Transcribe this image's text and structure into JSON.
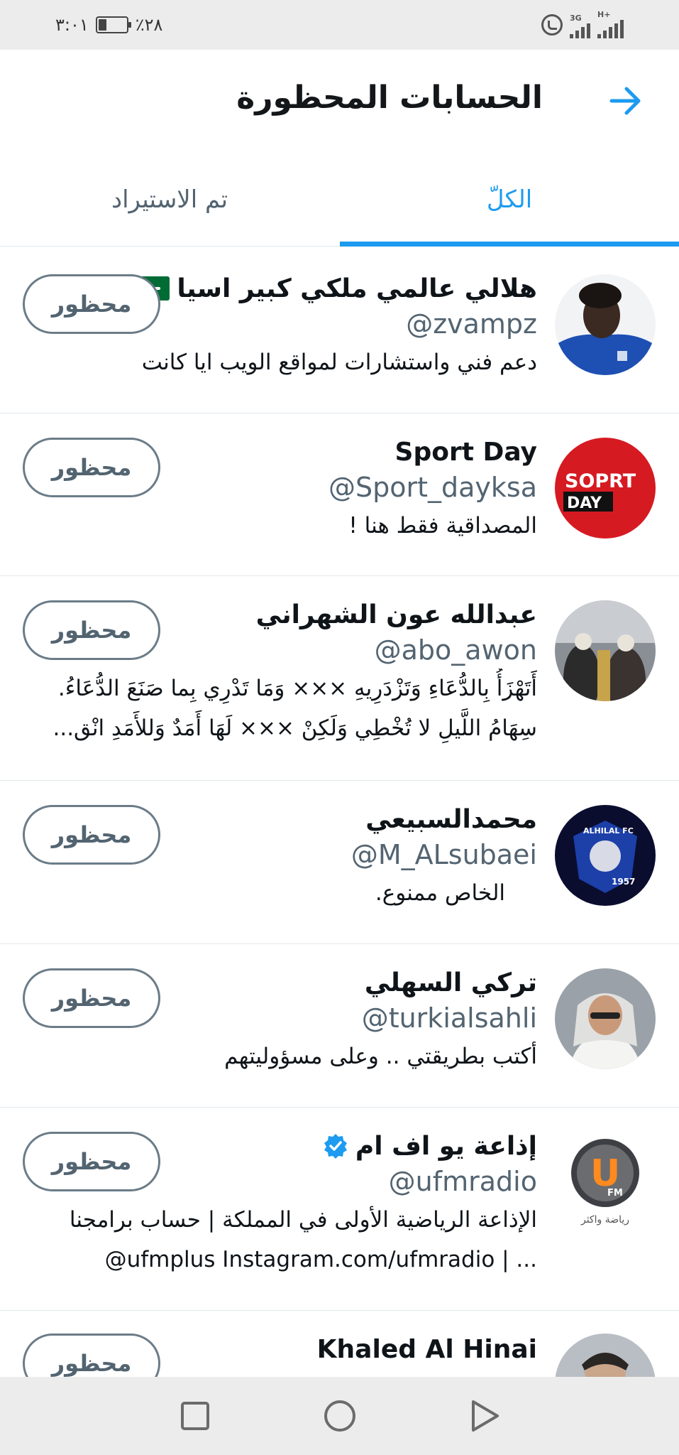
{
  "status_bar": {
    "time": "٣:٠١",
    "battery_percent": "٪٢٨",
    "battery_level": 0.28,
    "network_1": "3G",
    "network_2": "H+"
  },
  "header": {
    "title": "الحسابات المحظورة",
    "back_icon": "arrow-right-icon"
  },
  "tabs": {
    "all": "الكلّ",
    "imported": "تم الاستيراد",
    "active": "all"
  },
  "accounts": [
    {
      "name": "هلالي عالمي ملكي كبير اسيا",
      "badge": "flag",
      "handle": "@zvampz",
      "bio_lines": [
        "دعم فني واستشارات لمواقع الويب ايا كانت"
      ],
      "button": "محظور"
    },
    {
      "name": "Sport Day",
      "badge": "",
      "handle": "@Sport_dayksa",
      "bio_lines": [
        "المصداقية فقط هنا !"
      ],
      "avatar_text_1": "SOPRT",
      "avatar_text_2": "DAY",
      "button": "محظور"
    },
    {
      "name": "عبدالله عون الشهراني",
      "badge": "",
      "handle": "@abo_awon",
      "bio_lines": [
        "أَتَهْزَأُ بِالدُّعَاءِ وَتَزْدَرِيهِ ××× وَمَا تَدْرِي بِما صَنَعَ الدُّعَاءُ.",
        "سِهَامُ اللَّيلِ لا تُخْطِي وَلَكِنْ ××× لَهَا أَمَدٌ وَللأَمَدِ انْق..."
      ],
      "button": "محظور"
    },
    {
      "name": "محمدالسبيعي",
      "badge": "",
      "handle": "@M_ALsubaei",
      "bio_lines": [
        "الخاص ممنوع."
      ],
      "avatar_text_1": "ALHILAL FC",
      "avatar_text_2": "1957",
      "button": "محظور"
    },
    {
      "name": "تركي السهلي",
      "badge": "",
      "handle": "@turkialsahli",
      "bio_lines": [
        "أكتب بطريقتي .. وعلى مسؤوليتهم"
      ],
      "button": "محظور"
    },
    {
      "name": "إذاعة يو اف ام",
      "badge": "verified",
      "handle": "@ufmradio",
      "bio_lines": [
        "الإذاعة الرياضية الأولى في المملكة | حساب برامجنا",
        "@ufmplus Instagram.com/ufmradio | ..."
      ],
      "avatar_text_1": "U",
      "avatar_text_2": "FM",
      "avatar_text_3": "رياضة واكثر",
      "button": "محظور"
    },
    {
      "name": "Khaled Al Hinai",
      "badge": "",
      "handle": "",
      "bio_lines": [],
      "button": "محظور"
    }
  ],
  "nav_bar": {
    "recents_icon": "square-icon",
    "home_icon": "circle-icon",
    "back_icon": "triangle-back-icon"
  },
  "colors": {
    "accent": "#1d9bf0",
    "secondary_text": "#536471",
    "divider": "#e1e8ed",
    "system_bar": "#ececec"
  }
}
